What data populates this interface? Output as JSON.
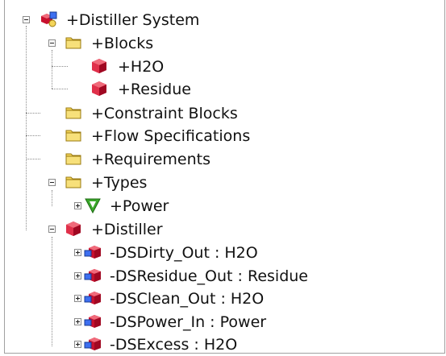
{
  "tree": {
    "root": {
      "label": "+Distiller System",
      "icon": "system-icon",
      "expanded": true
    },
    "blocks": {
      "label": "+Blocks",
      "icon": "folder-icon",
      "expanded": true
    },
    "h2o": {
      "label": "+H2O",
      "icon": "block-icon"
    },
    "residue": {
      "label": "+Residue",
      "icon": "block-icon"
    },
    "constraint_blocks": {
      "label": "+Constraint Blocks",
      "icon": "folder-icon"
    },
    "flow_specifications": {
      "label": "+Flow Specifications",
      "icon": "folder-icon"
    },
    "requirements": {
      "label": "+Requirements",
      "icon": "folder-icon"
    },
    "types": {
      "label": "+Types",
      "icon": "folder-icon",
      "expanded": true
    },
    "power": {
      "label": "+Power",
      "icon": "value-type-icon",
      "expanded": false
    },
    "distiller": {
      "label": "+Distiller",
      "icon": "block-icon",
      "expanded": true
    },
    "ds_dirty_out": {
      "label": "-DSDirty_Out : H2O",
      "icon": "port-icon",
      "expanded": false
    },
    "ds_residue_out": {
      "label": "-DSResidue_Out : Residue",
      "icon": "port-icon",
      "expanded": false
    },
    "ds_clean_out": {
      "label": "-DSClean_Out : H2O",
      "icon": "port-icon",
      "expanded": false
    },
    "ds_power_in": {
      "label": "-DSPower_In : Power",
      "icon": "port-icon",
      "expanded": false
    },
    "ds_excess": {
      "label": "-DSExcess : H2O",
      "icon": "port-icon",
      "expanded": false
    }
  },
  "colors": {
    "folder": "#f2d14a",
    "block": "#d8203a",
    "port": "#2a5bd7",
    "value_type": "#3aa82a"
  }
}
